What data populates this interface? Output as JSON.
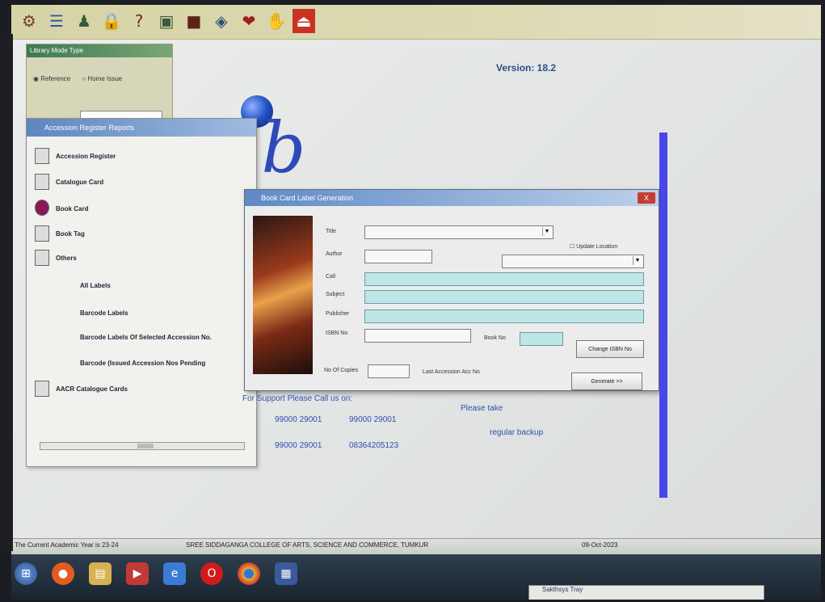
{
  "toolbar": {
    "buttons": [
      "gear-icon",
      "list-icon",
      "person-icon",
      "lock-icon",
      "help-icon",
      "card-icon",
      "box-icon",
      "heart-icon",
      "hand-icon",
      "exit-icon"
    ]
  },
  "library_panel": {
    "title": "Library Mode Type",
    "radio_one": "Reference",
    "radio_two": "Home Issue"
  },
  "app": {
    "version": "Version: 18.2",
    "logo_text": "ib"
  },
  "accession_panel": {
    "title": "Accession Register Reports",
    "items": [
      "Accession Register",
      "Catalogue Card",
      "Book Card",
      "Book Tag",
      "Others",
      "All Labels",
      "Barcode Labels",
      "Barcode Labels Of Selected Accession No.",
      "Barcode (Issued Accession Nos Pending",
      "AACR Catalogue Cards"
    ]
  },
  "search_window": {
    "title": "Book Card Label Generation",
    "labels": {
      "title": "Title",
      "author": "Author",
      "call": "Call",
      "subject": "Subject",
      "publisher": "Publisher",
      "isbn": "ISBN No",
      "book_no": "Book No",
      "no_of_copies": "No Of Copies",
      "update_location": "Update Location",
      "last_accession": "Last Accession Acc No"
    },
    "buttons": {
      "change": "Change ISBN No",
      "generate": "Generate >>"
    },
    "close": "X"
  },
  "support": {
    "heading": "For Support Please Call us on:",
    "phone_1": "99000 29001",
    "phone_2": "99000 29001",
    "phone_3": "99000 29001",
    "phone_4": "08364205123",
    "please_take": "Please take",
    "regular_backup": "regular backup"
  },
  "status_bar": {
    "academic_year": "The Current Academic Year is 23-24",
    "college": "SREE SIDDAGANGA COLLEGE OF ARTS, SCIENCE AND COMMERCE, TUMKUR",
    "date": "09-Oct-2023"
  },
  "taskbar": {
    "notify_text": "Sakthsys Tray",
    "icons": [
      "windows-start-icon",
      "firefox-icon",
      "file-explorer-icon",
      "media-icon",
      "internet-explorer-icon",
      "opera-icon",
      "chrome-icon",
      "elib-app-icon"
    ]
  }
}
